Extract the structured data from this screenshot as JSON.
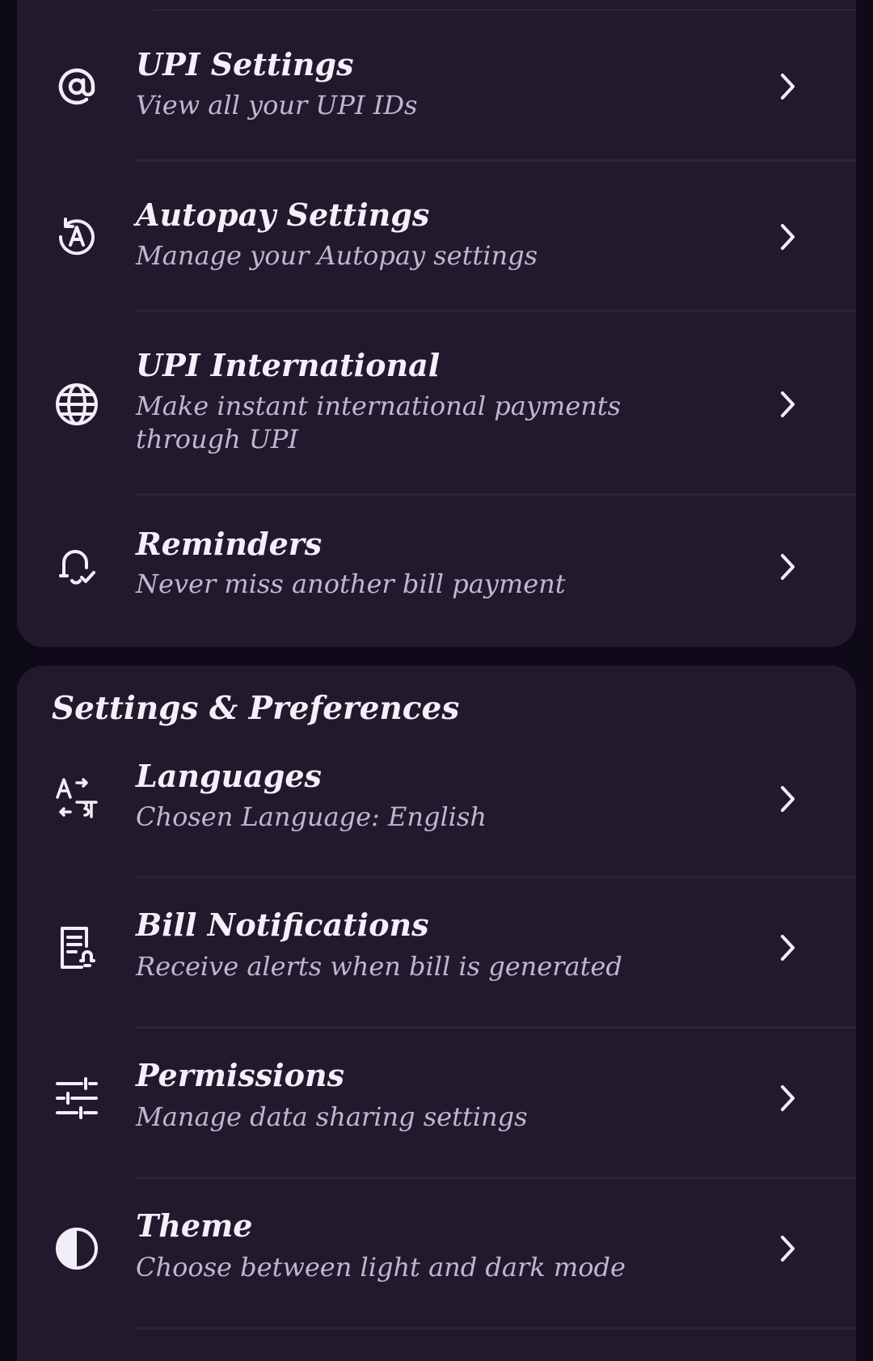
{
  "payments_section": {
    "items": [
      {
        "icon": "at-sign-icon",
        "title": "UPI Settings",
        "subtitle": "View all your UPI IDs"
      },
      {
        "icon": "autopay-icon",
        "title": "Autopay Settings",
        "subtitle": "Manage your Autopay settings"
      },
      {
        "icon": "globe-icon",
        "title": "UPI International",
        "subtitle": "Make instant international payments through UPI"
      },
      {
        "icon": "bell-check-icon",
        "title": "Reminders",
        "subtitle": "Never miss another bill payment"
      }
    ]
  },
  "settings_section": {
    "title": "Settings & Preferences",
    "items": [
      {
        "icon": "translate-icon",
        "title": "Languages",
        "subtitle": "Chosen Language: English"
      },
      {
        "icon": "bill-notification-icon",
        "title": "Bill Notifications",
        "subtitle": "Receive alerts when bill is generated"
      },
      {
        "icon": "sliders-icon",
        "title": "Permissions",
        "subtitle": "Manage data sharing settings"
      },
      {
        "icon": "contrast-icon",
        "title": "Theme",
        "subtitle": "Choose between light and dark mode"
      }
    ]
  },
  "colors": {
    "background": "#0f0a18",
    "card": "#211a2d",
    "title_text": "#f4f0fa",
    "subtitle_text": "#c1b6d2",
    "divider": "#2c2439"
  }
}
